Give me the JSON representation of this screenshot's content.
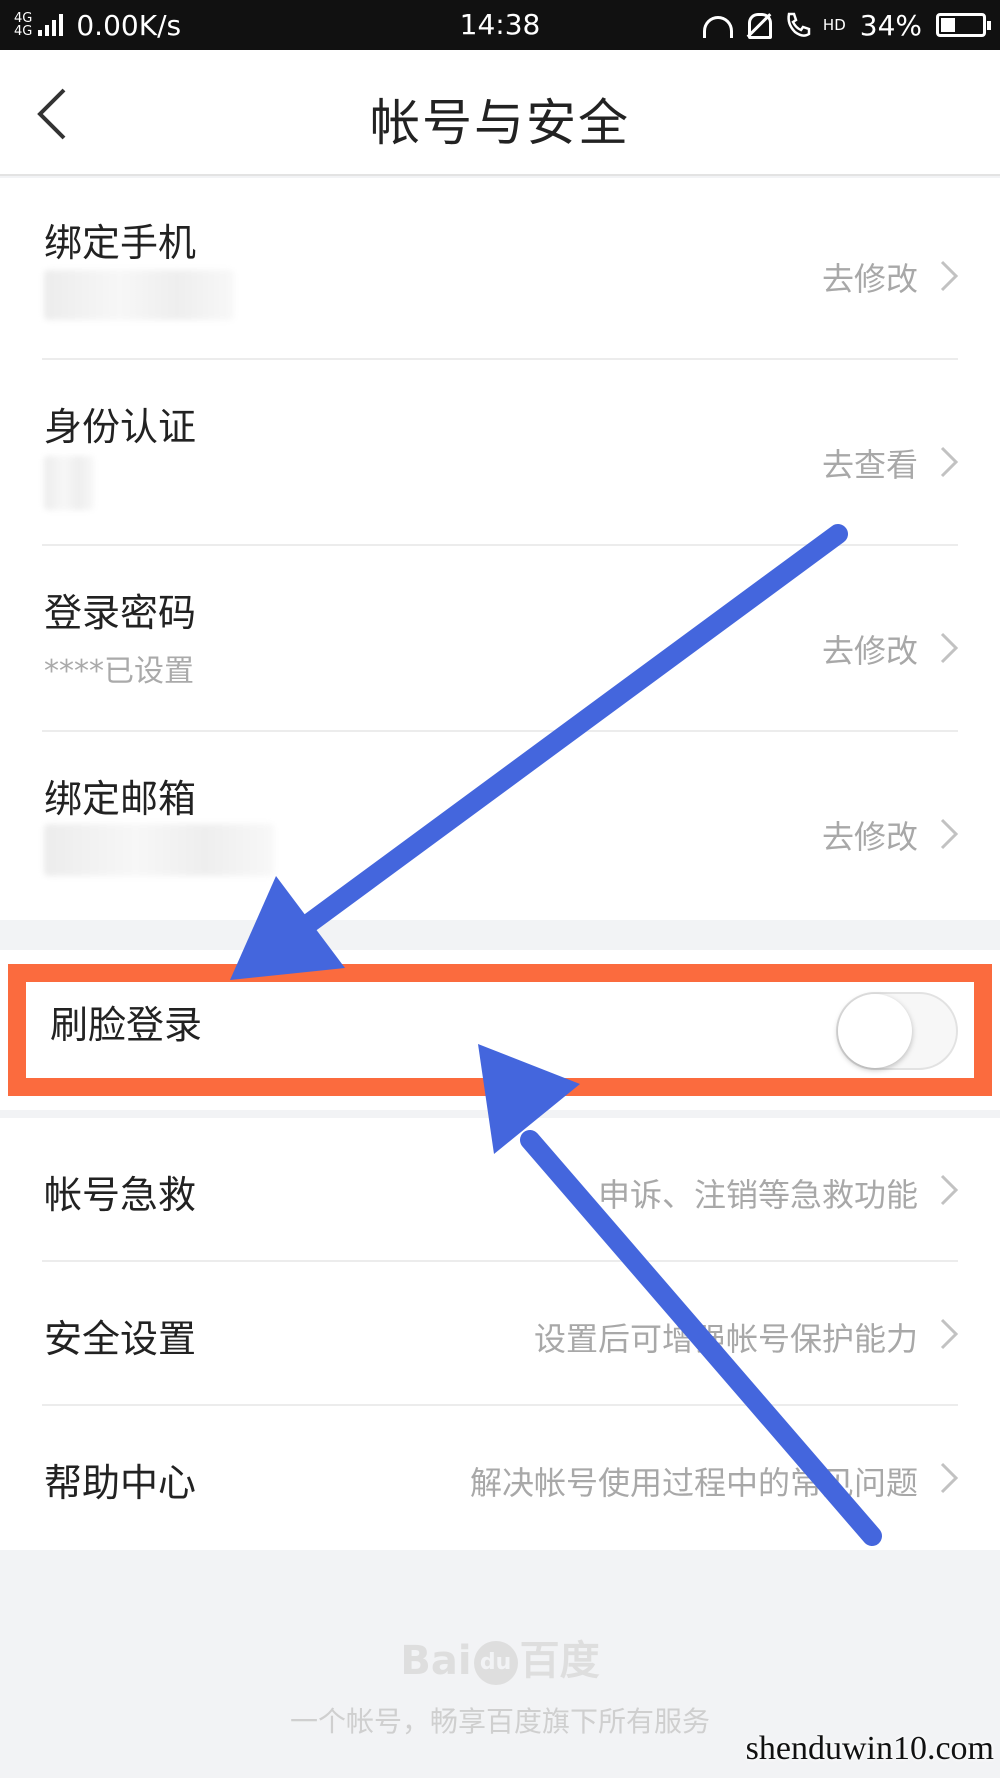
{
  "status_bar": {
    "network_top": "4G",
    "network_bottom": "4G",
    "speed": "0.00K/s",
    "time": "14:38",
    "hd": "HD",
    "battery": "34%",
    "battery_level": 0.34
  },
  "header": {
    "title": "帐号与安全",
    "back_icon": "chevron-left-icon"
  },
  "group1": [
    {
      "title": "绑定手机",
      "subtitle": "",
      "action": "去修改"
    },
    {
      "title": "身份认证",
      "subtitle": "",
      "action": "去查看"
    },
    {
      "title": "登录密码",
      "subtitle": "****已设置",
      "action": "去修改"
    },
    {
      "title": "绑定邮箱",
      "subtitle": "",
      "action": "去修改"
    }
  ],
  "face_login": {
    "title": "刷脸登录",
    "enabled": false,
    "highlight_color": "#fb6b3e"
  },
  "group2": [
    {
      "title": "帐号急救",
      "action": "申诉、注销等急救功能"
    },
    {
      "title": "安全设置",
      "action": "设置后可增强帐号保护能力"
    },
    {
      "title": "帮助中心",
      "action": "解决帐号使用过程中的常见问题"
    }
  ],
  "footer": {
    "logo_left": "Bai",
    "logo_paw": "du",
    "logo_right": "百度",
    "slogan": "一个帐号，畅享百度旗下所有服务"
  },
  "watermark": "shenduwin10.com",
  "annotation": {
    "arrow_color": "#4466dd"
  }
}
